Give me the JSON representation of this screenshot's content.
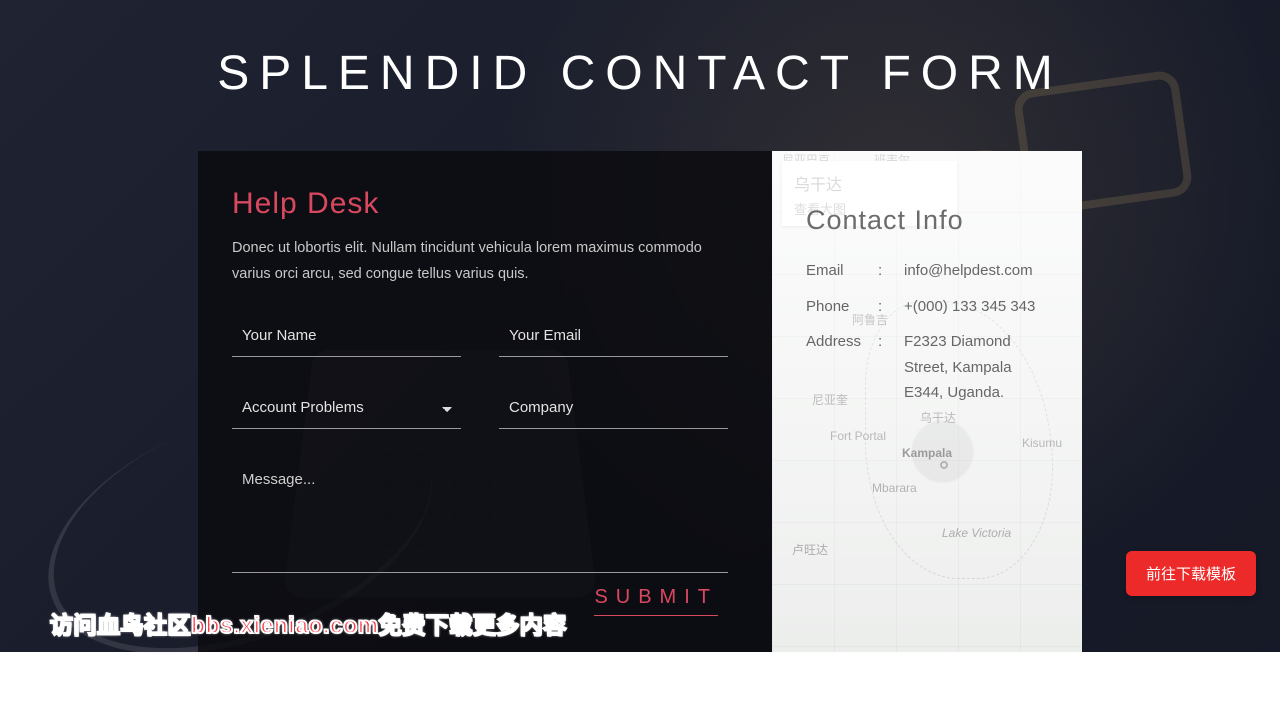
{
  "page_title": "SPLENDID CONTACT FORM",
  "help_desk": {
    "heading": "Help Desk",
    "description": "Donec ut lobortis elit. Nullam tincidunt vehicula lorem maximus commodo varius orci arcu, sed congue tellus varius quis."
  },
  "form": {
    "name_placeholder": "Your Name",
    "email_placeholder": "Your Email",
    "topic_selected": "Account Problems",
    "company_placeholder": "Company",
    "message_placeholder": "Message...",
    "submit_label": "SUBMIT"
  },
  "contact_info": {
    "heading": "Contact Info",
    "rows": [
      {
        "label": "Email",
        "value": "info@helpdest.com"
      },
      {
        "label": "Phone",
        "value": "+(000) 133 345 343"
      },
      {
        "label": "Address",
        "value": "F2323 Diamond Street, Kampala E344, Uganda."
      }
    ]
  },
  "map": {
    "infobox_title": "乌干达",
    "infobox_subtitle": "查看大图",
    "labels": {
      "l1": "尼亚巴克",
      "l2": "班韦尔",
      "l3": "阿鲁吉",
      "l4": "尼亚奎",
      "l5": "Kampala",
      "l6": "Fort Portal",
      "l7": "Mbarara",
      "l8": "Kisumu",
      "l9": "卢旺达",
      "l10": "Lake Victoria",
      "l11": "乌干达"
    }
  },
  "download_button_label": "前往下载模板",
  "watermark_text": "访问血鸟社区bbs.xieniao.com免费下载更多内容"
}
